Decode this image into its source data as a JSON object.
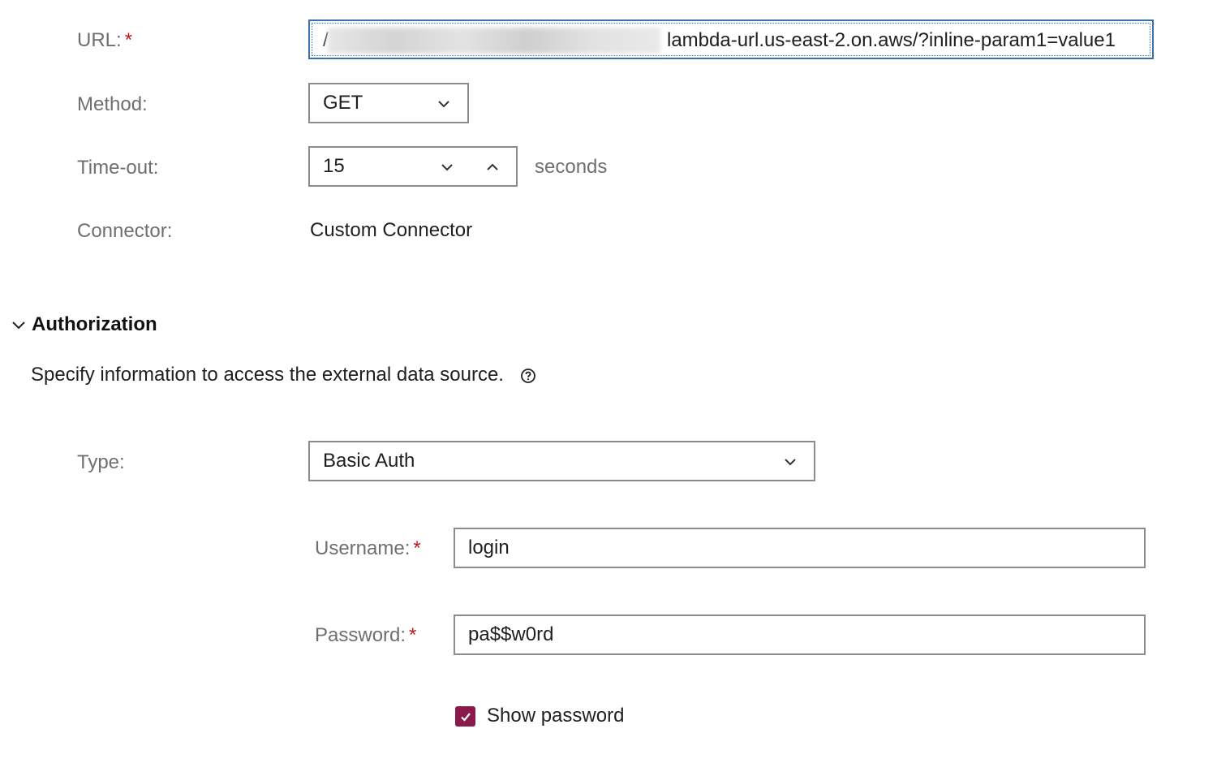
{
  "url": {
    "label": "URL:",
    "required_mark": "*",
    "value_leading": "/",
    "value": "lambda-url.us-east-2.on.aws/?inline-param1=value1"
  },
  "method": {
    "label": "Method:",
    "value": "GET"
  },
  "timeout": {
    "label": "Time-out:",
    "value": "15",
    "unit": "seconds"
  },
  "connector": {
    "label": "Connector:",
    "value": "Custom Connector"
  },
  "authorization": {
    "section_title": "Authorization",
    "description": "Specify information to access the external data source.",
    "type": {
      "label": "Type:",
      "value": "Basic Auth"
    },
    "username": {
      "label": "Username:",
      "required_mark": "*",
      "value": "login"
    },
    "password": {
      "label": "Password:",
      "required_mark": "*",
      "value": "pa$$w0rd"
    },
    "show_password": {
      "label": "Show password",
      "checked": true
    }
  },
  "colors": {
    "accent_checkbox": "#8a1a4b",
    "required": "#c4161c",
    "focus_border": "#3a6fb0"
  }
}
